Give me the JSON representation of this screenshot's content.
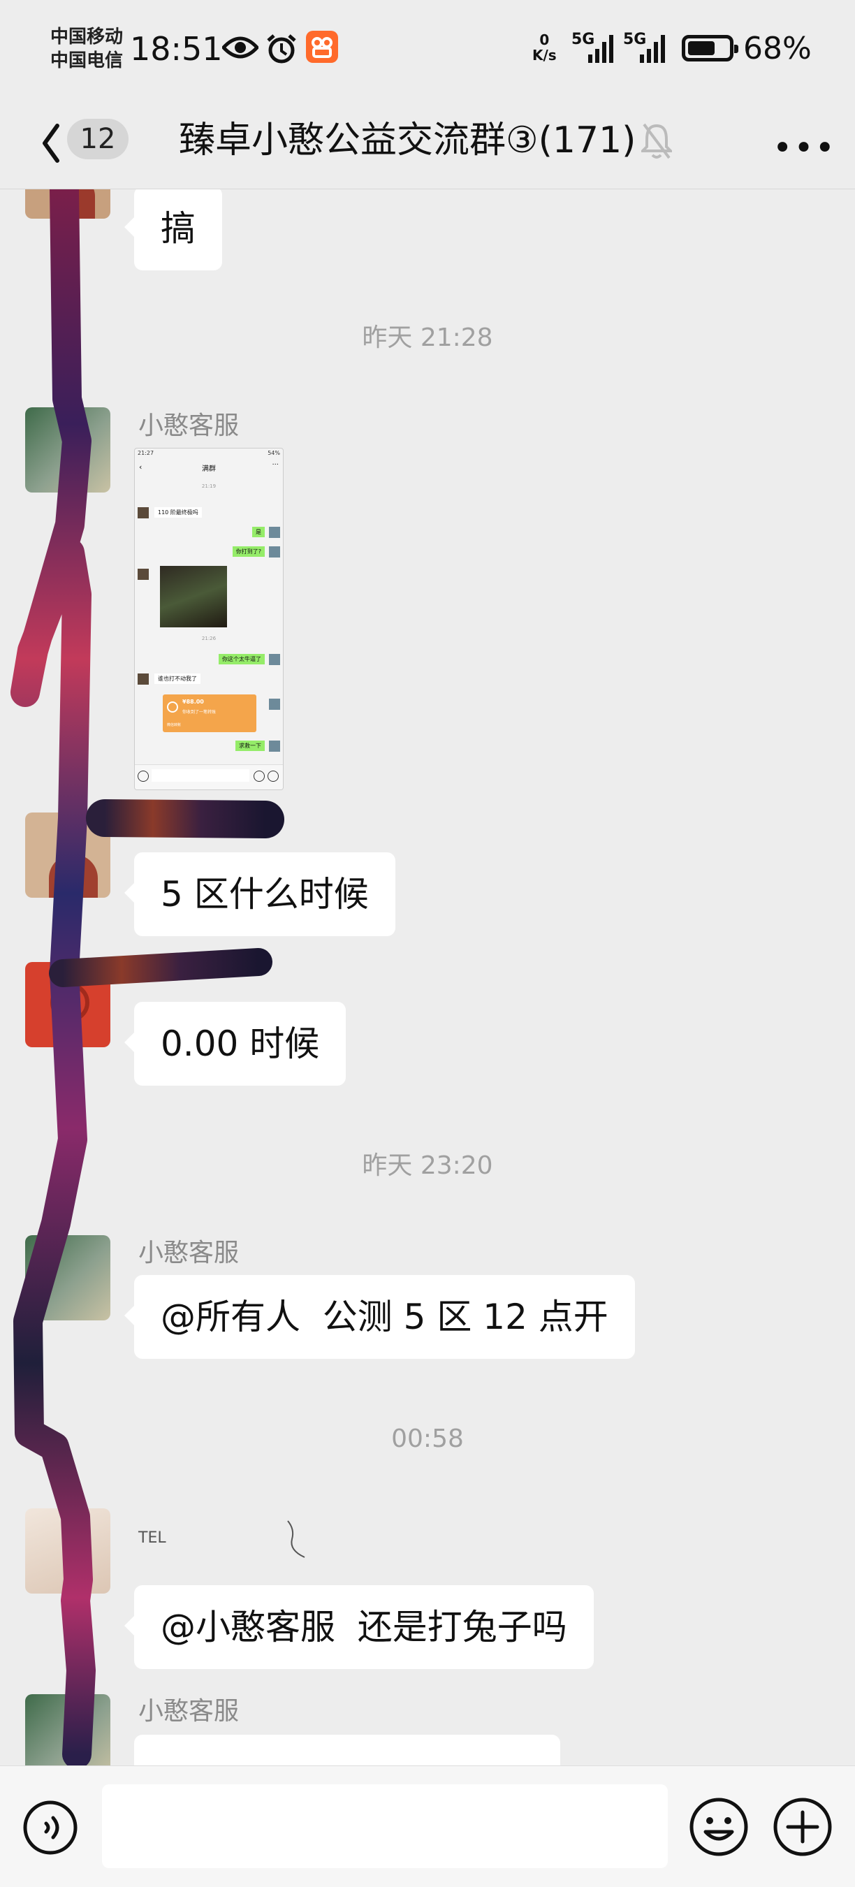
{
  "status_bar": {
    "carrier_1": "中国移动",
    "carrier_2": "中国电信",
    "time": "18:51",
    "net_speed_value": "0",
    "net_speed_unit": "K/s",
    "signal_1_label": "5G",
    "signal_2_label": "5G",
    "battery_level": 0.68,
    "battery_percent": "68%",
    "icons": [
      "eye-icon",
      "alarm-icon",
      "app-notification-icon",
      "signal-icon",
      "battery-icon"
    ]
  },
  "nav": {
    "back_icon": "chevron-left-icon",
    "unread_count": "12",
    "title": "臻卓小憨公益交流群③(171)",
    "mute_icon": "bell-muted-icon",
    "more_icon": "more-dots-icon"
  },
  "messages": [
    {
      "type": "text",
      "sender": "",
      "text": "搞"
    },
    {
      "type": "timestamp",
      "text": "昨天 21:28"
    },
    {
      "type": "image",
      "sender": "小憨客服",
      "screenshot": {
        "status_time": "21:27",
        "status_battery": "54%",
        "title": "满群",
        "timestamp_1": "21:19",
        "timestamp_2": "21:26",
        "msgs": [
          "110 阶最终极吗",
          "是",
          "你打到了?",
          "你这个太牛逼了",
          "谁也打不动我了",
          "¥88.00",
          "你收到了一笔转账",
          "微信转账",
          "求救一下"
        ]
      }
    },
    {
      "type": "text",
      "sender": "",
      "text": "5 区什么时候"
    },
    {
      "type": "text",
      "sender": "",
      "text": "0.00 时候"
    },
    {
      "type": "timestamp",
      "text": "昨天 23:20"
    },
    {
      "type": "text",
      "sender": "小憨客服",
      "text": "@所有人  公测 5 区 12 点开"
    },
    {
      "type": "timestamp",
      "text": "00:58"
    },
    {
      "type": "text",
      "sender": "TEL",
      "text": "@小憨客服  还是打兔子吗"
    },
    {
      "type": "text",
      "sender": "小憨客服",
      "text": ""
    }
  ],
  "input_bar": {
    "voice_icon": "voice-icon",
    "emoji_icon": "emoji-icon",
    "add_icon": "plus-circle-icon"
  },
  "colors": {
    "background": "#ededed",
    "bubble": "#ffffff",
    "timestamp_text": "#a0a0a0",
    "sender_text": "#8a8a8a",
    "wechat_green": "#95ec69"
  }
}
